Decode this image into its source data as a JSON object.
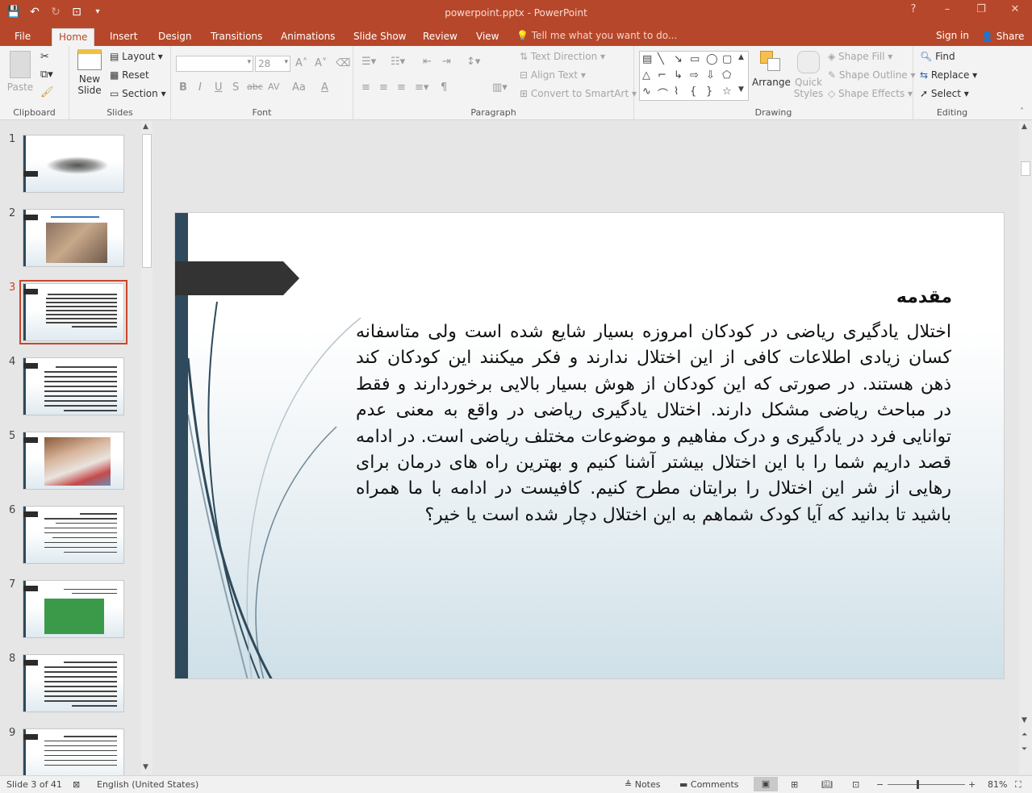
{
  "window": {
    "title": "powerpoint.pptx - PowerPoint",
    "controls": [
      "?",
      "–",
      "❐",
      "✕"
    ]
  },
  "qat": {
    "save": "💾",
    "undo": "↶",
    "redo": "↻",
    "present": "⊡",
    "more": "▾"
  },
  "tabs": [
    {
      "label": "File"
    },
    {
      "label": "Home",
      "active": true
    },
    {
      "label": "Insert"
    },
    {
      "label": "Design"
    },
    {
      "label": "Transitions"
    },
    {
      "label": "Animations"
    },
    {
      "label": "Slide Show"
    },
    {
      "label": "Review"
    },
    {
      "label": "View"
    }
  ],
  "tellme": "Tell me what you want to do...",
  "signin": "Sign in",
  "share": "Share",
  "ribbon": {
    "clipboard": {
      "label": "Clipboard",
      "paste": "Paste"
    },
    "slides": {
      "label": "Slides",
      "new_slide": "New\nSlide",
      "layout": "Layout",
      "reset": "Reset",
      "section": "Section"
    },
    "font": {
      "label": "Font",
      "size": "28",
      "bold": "B",
      "italic": "I",
      "underline": "U",
      "shadow": "S",
      "strike": "abc",
      "spacing": "AV",
      "case": "Aa",
      "color": "A"
    },
    "paragraph": {
      "label": "Paragraph",
      "text_direction": "Text Direction",
      "align_text": "Align Text",
      "convert": "Convert to SmartArt"
    },
    "drawing": {
      "label": "Drawing",
      "arrange": "Arrange",
      "quick_styles": "Quick\nStyles",
      "shape_fill": "Shape Fill",
      "shape_outline": "Shape Outline",
      "shape_effects": "Shape Effects"
    },
    "editing": {
      "label": "Editing",
      "find": "Find",
      "replace": "Replace",
      "select": "Select"
    }
  },
  "slides_count_total": 41,
  "thumbnails": [
    "1",
    "2",
    "3",
    "4",
    "5",
    "6",
    "7",
    "8",
    "9"
  ],
  "current_slide": {
    "title": "مقدمه",
    "body": "اختلال یادگیری ریاضی در کودکان امروزه بسیار شایع شده است ولی متاسفانه کسان زیادی اطلاعات کافی از این اختلال ندارند و فکر میکنند این کودکان کند ذهن هستند. در صورتی که این کودکان از هوش بسیار بالایی برخوردارند و فقط در مباحث ریاضی مشکل دارند. اختلال یادگیری ریاضی در واقع به معنی عدم توانایی فرد در یادگیری و درک مفاهیم و موضوعات مختلف ریاضی است. در ادامه قصد داریم شما را با این اختلال بیشتر آشنا کنیم و بهترین راه های درمان برای رهایی از شر این اختلال را برایتان مطرح کنیم. کافیست در ادامه با ما همراه باشید تا بدانید که آیا کودک شماهم به این اختلال دچار شده است یا خیر؟"
  },
  "status": {
    "slide_info": "Slide 3 of 41",
    "language": "English (United States)",
    "notes": "Notes",
    "comments": "Comments",
    "zoom": "81%"
  },
  "colors": {
    "accent": "#b7472a",
    "slide_bar": "#2e4a5c"
  }
}
